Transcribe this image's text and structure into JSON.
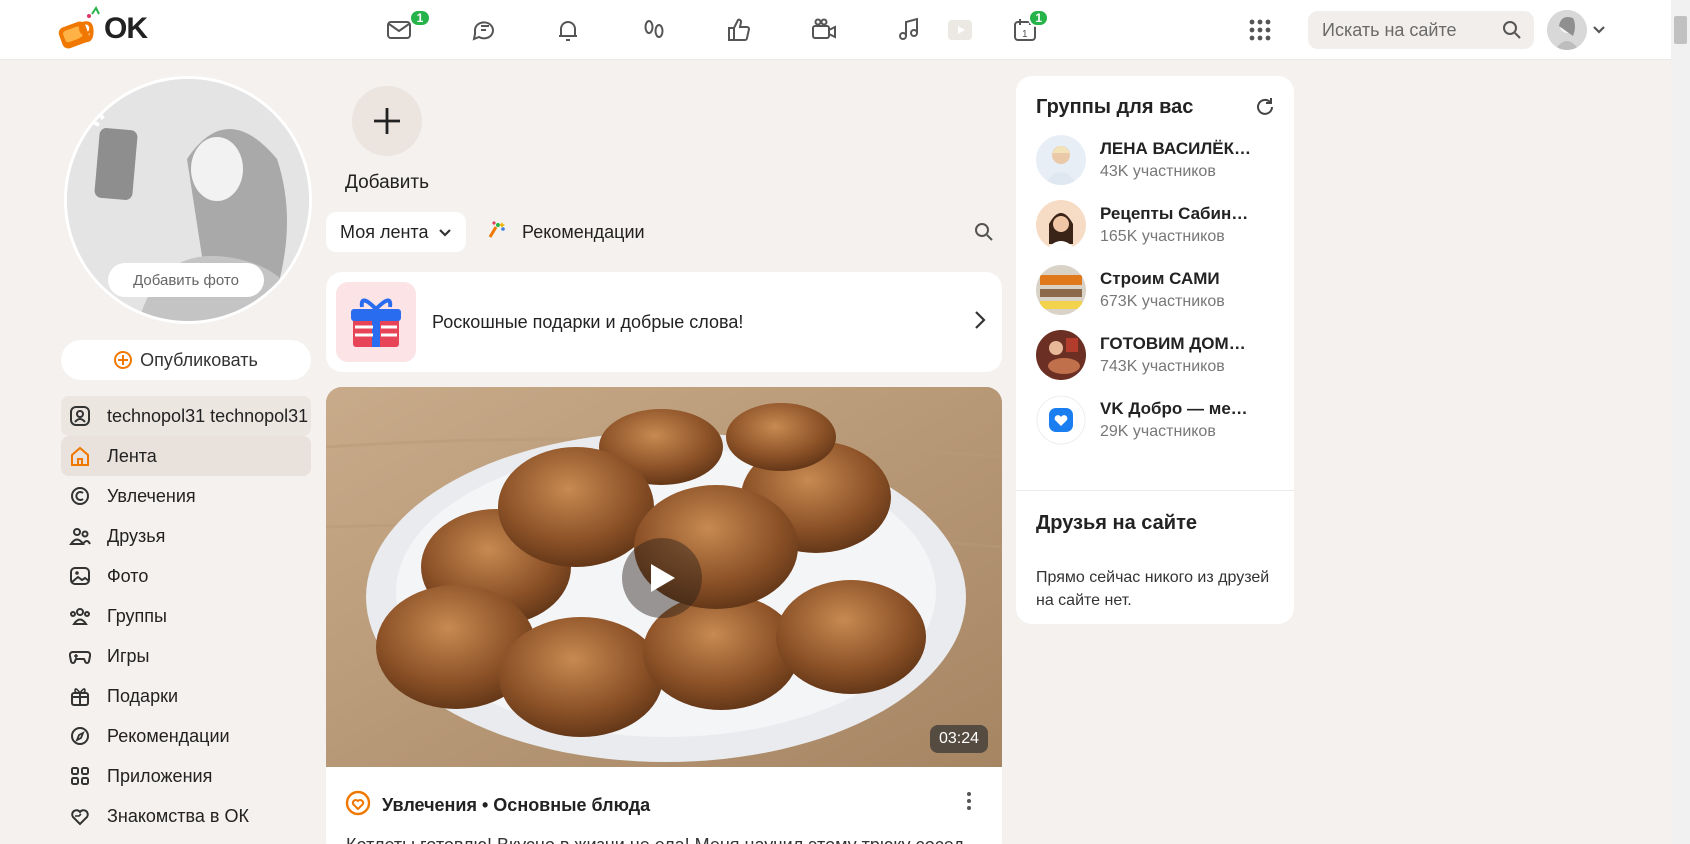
{
  "header": {
    "logo_text": "OK",
    "message_badge": "1",
    "events_badge": "1",
    "search_placeholder": "Искать на сайте"
  },
  "profile": {
    "add_photo_label": "Добавить фото",
    "publish_label": "Опубликовать"
  },
  "sidebar": {
    "items": [
      {
        "label": "technopol31 technopol31",
        "icon": "user-icon"
      },
      {
        "label": "Лента",
        "icon": "home-icon"
      },
      {
        "label": "Увлечения",
        "icon": "hobbies-icon"
      },
      {
        "label": "Друзья",
        "icon": "friends-icon"
      },
      {
        "label": "Фото",
        "icon": "photo-icon"
      },
      {
        "label": "Группы",
        "icon": "groups-icon"
      },
      {
        "label": "Игры",
        "icon": "gamepad-icon"
      },
      {
        "label": "Подарки",
        "icon": "gift-icon"
      },
      {
        "label": "Рекомендации",
        "icon": "compass-icon"
      },
      {
        "label": "Приложения",
        "icon": "apps-icon"
      },
      {
        "label": "Знакомства в ОК",
        "icon": "dating-icon"
      }
    ]
  },
  "feed": {
    "add_label": "Добавить",
    "my_feed_label": "Моя лента",
    "recommendations_label": "Рекомендации",
    "gift_banner_text": "Роскошные подарки и добрые слова!",
    "post": {
      "duration": "03:24",
      "category": "Увлечения • Основные блюда",
      "text": "Котлеты готовлю! Вкусно в жизни не ела! Меня научил этому трюку сосед"
    }
  },
  "groups": {
    "title": "Группы для вас",
    "items": [
      {
        "name": "ЛЕНА ВАСИЛЁК. Отдел кадров",
        "members": "43K участников"
      },
      {
        "name": "Рецепты Сабины кулинария",
        "members": "165K участников"
      },
      {
        "name": "Строим САМИ",
        "members": "673K участников"
      },
      {
        "name": "ГОТОВИМ ДОМА вкусно",
        "members": "743K участников"
      },
      {
        "name": "VK Добро — место добрых дел",
        "members": "29K участников"
      }
    ]
  },
  "friends": {
    "title": "Друзья на сайте",
    "text": "Прямо сейчас никого из друзей на сайте нет."
  },
  "colors": {
    "accent": "#f07700",
    "badge": "#26b34a",
    "background": "#f4f1ee"
  }
}
